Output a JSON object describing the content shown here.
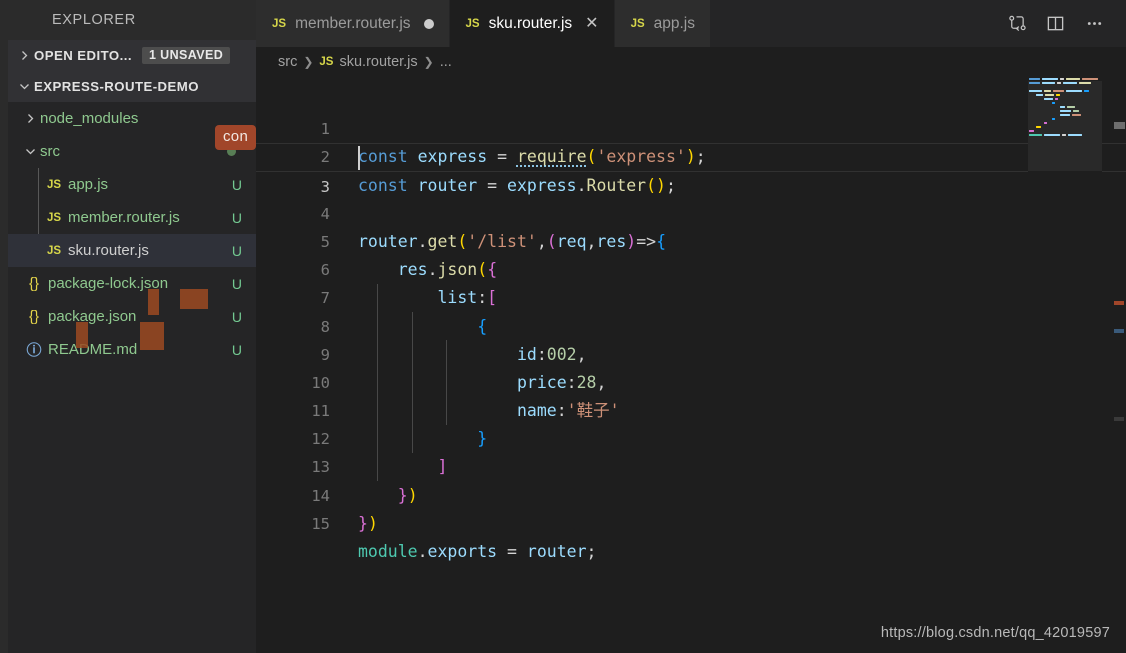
{
  "window": {
    "theme_bg": "#1e1e1e",
    "sidebar_bg": "#252526",
    "accent": "#d7d74a"
  },
  "sidebar": {
    "title": "EXPLORER",
    "sections": [
      {
        "label": "OPEN EDITO...",
        "badge": "1 UNSAVED",
        "expanded": false
      },
      {
        "label": "EXPRESS-ROUTE-DEMO",
        "badge": "",
        "expanded": true
      }
    ],
    "ime_badge": "con",
    "tree": [
      {
        "name": "node_modules",
        "icon": "folder",
        "icon_label": "",
        "status": "",
        "indent": 1,
        "expanded": false,
        "selected": false,
        "has_dot": false
      },
      {
        "name": "src",
        "icon": "folder",
        "icon_label": "",
        "status": "",
        "indent": 1,
        "expanded": true,
        "selected": false,
        "has_dot": true
      },
      {
        "name": "app.js",
        "icon": "js",
        "icon_label": "JS",
        "status": "U",
        "indent": 2,
        "expanded": null,
        "selected": false,
        "has_dot": false
      },
      {
        "name": "member.router.js",
        "icon": "js",
        "icon_label": "JS",
        "status": "U",
        "indent": 2,
        "expanded": null,
        "selected": false,
        "has_dot": false
      },
      {
        "name": "sku.router.js",
        "icon": "js",
        "icon_label": "JS",
        "status": "U",
        "indent": 2,
        "expanded": null,
        "selected": true,
        "has_dot": false
      },
      {
        "name": "package-lock.json",
        "icon": "json",
        "icon_label": "{}",
        "status": "U",
        "indent": 1,
        "expanded": null,
        "selected": false,
        "has_dot": false
      },
      {
        "name": "package.json",
        "icon": "json",
        "icon_label": "{}",
        "status": "U",
        "indent": 1,
        "expanded": null,
        "selected": false,
        "has_dot": false
      },
      {
        "name": "README.md",
        "icon": "md",
        "icon_label": "ⓘ",
        "status": "U",
        "indent": 1,
        "expanded": null,
        "selected": false,
        "has_dot": false
      }
    ]
  },
  "tabs": [
    {
      "icon_label": "JS",
      "label": "member.router.js",
      "active": false,
      "dirty": true
    },
    {
      "icon_label": "JS",
      "label": "sku.router.js",
      "active": true,
      "dirty": false
    },
    {
      "icon_label": "JS",
      "label": "app.js",
      "active": false,
      "dirty": false
    }
  ],
  "tab_actions": [
    {
      "name": "split-diff-icon",
      "title": "Open Changes"
    },
    {
      "name": "split-editor-icon",
      "title": "Split Editor"
    },
    {
      "name": "more-actions-icon",
      "title": "More Actions..."
    }
  ],
  "breadcrumb": {
    "folder": "src",
    "file_icon": "JS",
    "file": "sku.router.js",
    "tail": "..."
  },
  "editor": {
    "language": "javascript",
    "cursor_line": 3,
    "cursor_column": 1,
    "total_lines": 15,
    "lines": [
      {
        "n": 1,
        "text": "const express = require('express');"
      },
      {
        "n": 2,
        "text": "const router = express.Router();"
      },
      {
        "n": 3,
        "text": ""
      },
      {
        "n": 4,
        "text": "router.get('/list',(req,res)=>{"
      },
      {
        "n": 5,
        "text": "    res.json({"
      },
      {
        "n": 6,
        "text": "        list:["
      },
      {
        "n": 7,
        "text": "            {"
      },
      {
        "n": 8,
        "text": "                id:002,"
      },
      {
        "n": 9,
        "text": "                price:28,"
      },
      {
        "n": 10,
        "text": "                name:'鞋子'"
      },
      {
        "n": 11,
        "text": "            }"
      },
      {
        "n": 12,
        "text": "        ]"
      },
      {
        "n": 13,
        "text": "    })"
      },
      {
        "n": 14,
        "text": "})"
      },
      {
        "n": 15,
        "text": "module.exports = router;"
      }
    ],
    "token_colors": {
      "keyword": "#569cd6",
      "identifier": "#9cdcfe",
      "function": "#dcdcaa",
      "string": "#ce9178",
      "number": "#b5cea8",
      "operator": "#d4d4d4",
      "bracket_1": "#ffd700",
      "bracket_2": "#da70d6",
      "bracket_3": "#179fff",
      "module": "#4ec9b0",
      "line_number": "#7a7a7a"
    }
  },
  "watermark": "https://blog.csdn.net/qq_42019597"
}
